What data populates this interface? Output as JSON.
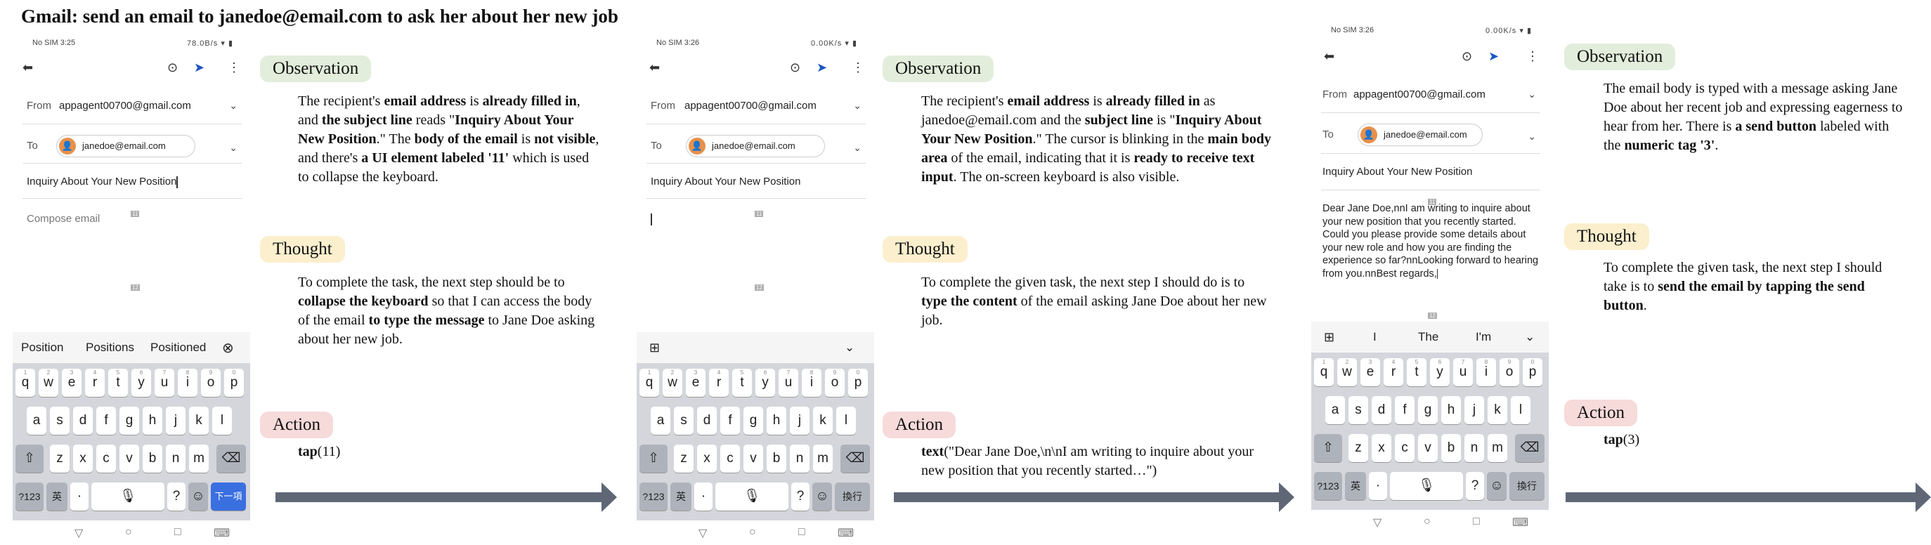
{
  "task_title": "Gmail: send an email to janedoe@email.com to ask her about her new job",
  "steps": [
    {
      "status_left": "No SIM 3:25",
      "status_right": "78.0B/s",
      "from_label": "From",
      "from_value": "appagent00700@gmail.com",
      "to_label": "To",
      "to_chip": "janedoe@email.com",
      "subject": "Inquiry About Your New Position",
      "compose_placeholder": "Compose email",
      "suggestions": [
        "Position",
        "Positions",
        "Positioned"
      ],
      "observation": "The recipient's <b>email address</b> is <b>already filled in</b>, and <b>the subject line</b> reads \"<b>Inquiry About Your New Position</b>.\" The <b>body of the email</b> is <b>not visible</b>, and there's <b>a UI element labeled '11'</b> which is used to collapse the keyboard.",
      "thought": "To complete the task, the next step should be to <b>collapse the keyboard</b> so that I can access the body of the email <b>to type the message</b> to Jane Doe asking about her new job.",
      "action": "<b>tap</b>(11)"
    },
    {
      "status_left": "No SIM 3:26",
      "status_right": "0.00K/s",
      "from_label": "From",
      "from_value": "appagent00700@gmail.com",
      "to_label": "To",
      "to_chip": "janedoe@email.com",
      "subject": "Inquiry About Your New Position",
      "observation": "The recipient's <b>email address</b> is <b>already filled in</b> as janedoe@email.com and the <b>subject line</b> is \"<b>Inquiry About Your New Position</b>.\" The cursor is blinking in the <b>main body area</b> of the email, indicating that it is <b>ready to receive text input</b>. The on-screen keyboard is also visible.",
      "thought": "To complete the given task, the next step I should do is to <b>type the content</b> of the email asking Jane Doe about her new job.",
      "action": "<b>text</b>(\"Dear Jane Doe,\\n\\nI am writing to inquire about your new position that you recently started…\")"
    },
    {
      "status_left": "No SIM 3:26",
      "status_right": "0.00K/s",
      "from_label": "From",
      "from_value": "appagent00700@gmail.com",
      "to_label": "To",
      "to_chip": "janedoe@email.com",
      "subject": "Inquiry About Your New Position",
      "body": "Dear Jane Doe,nnI am writing to inquire about your new position that you recently started. Could you please provide some details about your new role and how you are finding the experience so far?nnLooking forward to hearing from you.nnBest regards,",
      "suggestions": [
        "I",
        "The",
        "I'm"
      ],
      "observation": "The email body is typed with a message asking Jane Doe about her recent job and expressing eagerness to hear from her. There is <b>a send button</b> labeled with the <b>numeric tag '3'</b>.",
      "thought": "To complete the given task, the next step I should take is to <b>send the email by tapping the send button</b>.",
      "action": "<b>tap</b>(3)"
    }
  ],
  "panel_labels": {
    "observation": "Observation",
    "thought": "Thought",
    "action": "Action"
  },
  "keyboard": {
    "row1": [
      "q",
      "w",
      "e",
      "r",
      "t",
      "y",
      "u",
      "i",
      "o",
      "p"
    ],
    "row1_nums": [
      "1",
      "2",
      "3",
      "4",
      "5",
      "6",
      "7",
      "8",
      "9",
      "0"
    ],
    "row2": [
      "a",
      "s",
      "d",
      "f",
      "g",
      "h",
      "j",
      "k",
      "l"
    ],
    "row3": [
      "z",
      "x",
      "c",
      "v",
      "b",
      "n",
      "m"
    ],
    "sym_key": "?123",
    "lang_key": "英",
    "comma_key": "·",
    "question_key": "?",
    "emoji_key": "☺",
    "next_key": "下一項",
    "enter_key": "換行"
  },
  "icons": [
    "back-arrow-icon",
    "attach-icon",
    "send-icon",
    "more-icon",
    "chevron-down-icon",
    "close-circle-icon",
    "shift-icon",
    "backspace-icon",
    "mic-icon",
    "nav-back-icon",
    "nav-home-icon",
    "nav-recents-icon",
    "keyboard-hide-icon"
  ]
}
